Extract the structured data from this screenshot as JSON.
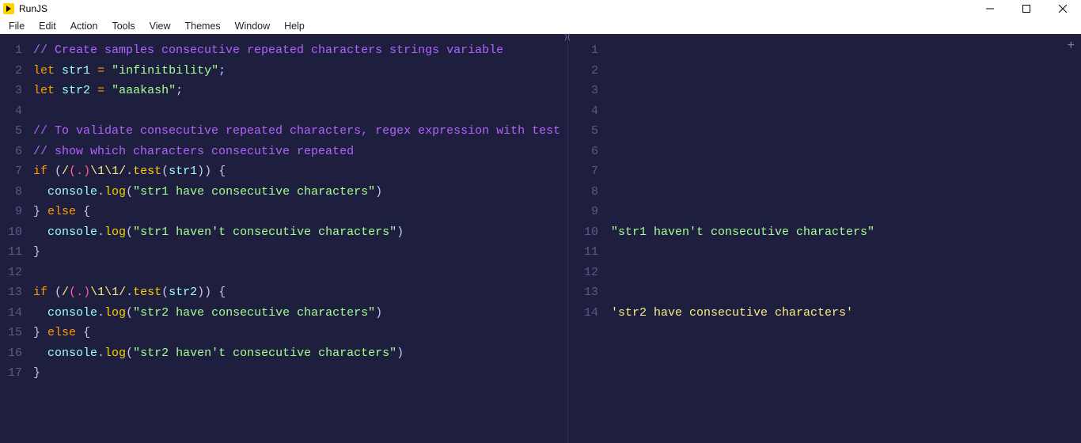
{
  "title": "RunJS",
  "menus": [
    "File",
    "Edit",
    "Action",
    "Tools",
    "View",
    "Themes",
    "Window",
    "Help"
  ],
  "editor": {
    "lines": [
      {
        "n": 1,
        "tokens": [
          [
            "comment",
            "// Create samples consecutive repeated characters strings variable"
          ]
        ]
      },
      {
        "n": 2,
        "tokens": [
          [
            "keyword",
            "let"
          ],
          [
            "sp",
            " "
          ],
          [
            "var",
            "str1"
          ],
          [
            "sp",
            " "
          ],
          [
            "op",
            "="
          ],
          [
            "sp",
            " "
          ],
          [
            "string",
            "\"infinitbility\""
          ],
          [
            "punc",
            ";"
          ]
        ]
      },
      {
        "n": 3,
        "tokens": [
          [
            "keyword",
            "let"
          ],
          [
            "sp",
            " "
          ],
          [
            "var",
            "str2"
          ],
          [
            "sp",
            " "
          ],
          [
            "op",
            "="
          ],
          [
            "sp",
            " "
          ],
          [
            "string",
            "\"aaakash\""
          ],
          [
            "punc",
            ";"
          ]
        ]
      },
      {
        "n": 4,
        "tokens": []
      },
      {
        "n": 5,
        "tokens": [
          [
            "comment",
            "// To validate consecutive repeated characters, regex expression with test method"
          ]
        ]
      },
      {
        "n": 6,
        "tokens": [
          [
            "comment",
            "// show which characters consecutive repeated"
          ]
        ]
      },
      {
        "n": 7,
        "tokens": [
          [
            "keyword2",
            "if"
          ],
          [
            "sp",
            " "
          ],
          [
            "punc",
            "("
          ],
          [
            "regex",
            "/"
          ],
          [
            "regex-grp",
            "(.)"
          ],
          [
            "regex",
            "\\1\\1/"
          ],
          [
            "punc",
            "."
          ],
          [
            "func",
            "test"
          ],
          [
            "punc",
            "("
          ],
          [
            "var",
            "str1"
          ],
          [
            "punc",
            "))"
          ],
          [
            "sp",
            " "
          ],
          [
            "punc",
            "{"
          ]
        ]
      },
      {
        "n": 8,
        "tokens": [
          [
            "sp",
            "  "
          ],
          [
            "prop",
            "console"
          ],
          [
            "punc",
            "."
          ],
          [
            "func",
            "log"
          ],
          [
            "punc",
            "("
          ],
          [
            "string",
            "\"str1 have consecutive characters\""
          ],
          [
            "punc",
            ")"
          ]
        ]
      },
      {
        "n": 9,
        "tokens": [
          [
            "punc",
            "}"
          ],
          [
            "sp",
            " "
          ],
          [
            "keyword2",
            "else"
          ],
          [
            "sp",
            " "
          ],
          [
            "punc",
            "{"
          ]
        ]
      },
      {
        "n": 10,
        "tokens": [
          [
            "sp",
            "  "
          ],
          [
            "prop",
            "console"
          ],
          [
            "punc",
            "."
          ],
          [
            "func",
            "log"
          ],
          [
            "punc",
            "("
          ],
          [
            "string",
            "\"str1 haven't consecutive characters\""
          ],
          [
            "punc",
            ")"
          ]
        ]
      },
      {
        "n": 11,
        "tokens": [
          [
            "punc",
            "}"
          ]
        ]
      },
      {
        "n": 12,
        "tokens": []
      },
      {
        "n": 13,
        "tokens": [
          [
            "keyword2",
            "if"
          ],
          [
            "sp",
            " "
          ],
          [
            "punc",
            "("
          ],
          [
            "regex",
            "/"
          ],
          [
            "regex-grp",
            "(.)"
          ],
          [
            "regex",
            "\\1\\1/"
          ],
          [
            "punc",
            "."
          ],
          [
            "func",
            "test"
          ],
          [
            "punc",
            "("
          ],
          [
            "var",
            "str2"
          ],
          [
            "punc",
            "))"
          ],
          [
            "sp",
            " "
          ],
          [
            "punc",
            "{"
          ]
        ]
      },
      {
        "n": 14,
        "tokens": [
          [
            "sp",
            "  "
          ],
          [
            "prop",
            "console"
          ],
          [
            "punc",
            "."
          ],
          [
            "func",
            "log"
          ],
          [
            "punc",
            "("
          ],
          [
            "string",
            "\"str2 have consecutive characters\""
          ],
          [
            "punc",
            ")"
          ]
        ]
      },
      {
        "n": 15,
        "tokens": [
          [
            "punc",
            "}"
          ],
          [
            "sp",
            " "
          ],
          [
            "keyword2",
            "else"
          ],
          [
            "sp",
            " "
          ],
          [
            "punc",
            "{"
          ]
        ]
      },
      {
        "n": 16,
        "tokens": [
          [
            "sp",
            "  "
          ],
          [
            "prop",
            "console"
          ],
          [
            "punc",
            "."
          ],
          [
            "func",
            "log"
          ],
          [
            "punc",
            "("
          ],
          [
            "string",
            "\"str2 haven't consecutive characters\""
          ],
          [
            "punc",
            ")"
          ]
        ]
      },
      {
        "n": 17,
        "tokens": [
          [
            "punc",
            "}"
          ]
        ]
      }
    ]
  },
  "output": {
    "lines": [
      {
        "n": 1,
        "tokens": []
      },
      {
        "n": 2,
        "tokens": []
      },
      {
        "n": 3,
        "tokens": []
      },
      {
        "n": 4,
        "tokens": []
      },
      {
        "n": 5,
        "tokens": []
      },
      {
        "n": 6,
        "tokens": []
      },
      {
        "n": 7,
        "tokens": []
      },
      {
        "n": 8,
        "tokens": []
      },
      {
        "n": 9,
        "tokens": []
      },
      {
        "n": 10,
        "tokens": [
          [
            "out-str",
            "\"str1 haven't consecutive characters\""
          ]
        ]
      },
      {
        "n": 11,
        "tokens": []
      },
      {
        "n": 12,
        "tokens": []
      },
      {
        "n": 13,
        "tokens": []
      },
      {
        "n": 14,
        "tokens": [
          [
            "out-str2",
            "'str2 have consecutive characters'"
          ]
        ]
      }
    ]
  },
  "plus_label": "+"
}
